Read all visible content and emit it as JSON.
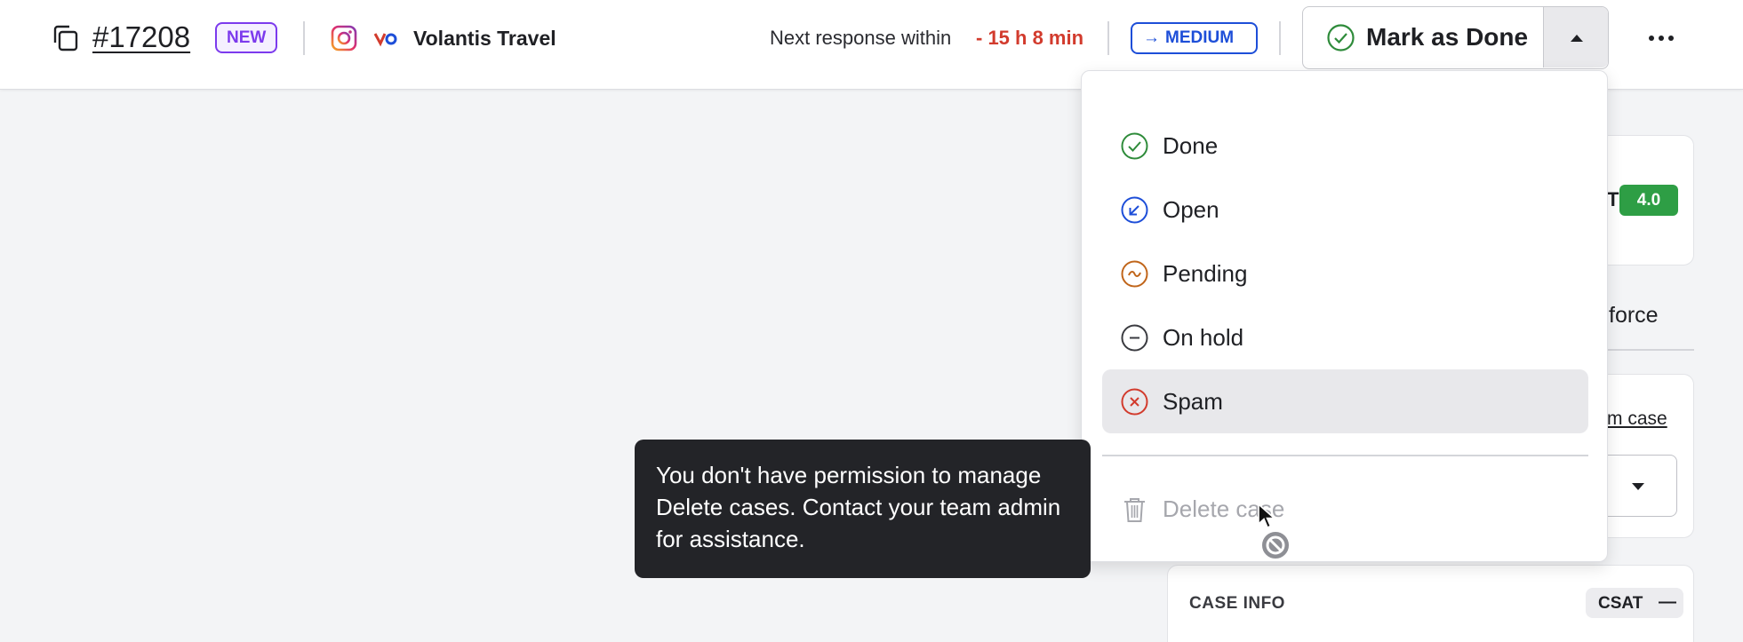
{
  "header": {
    "case_id": "#17208",
    "status_badge": "NEW",
    "company": "Volantis Travel",
    "next_response_label": "Next response within",
    "next_response_time": "- 15 h 8 min",
    "priority": "MEDIUM",
    "mark_done_label": "Mark as Done"
  },
  "background": {
    "card_top_text": "T",
    "score": "4.0",
    "force_text": "force",
    "link_text": "m case",
    "case_info_title": "CASE INFO",
    "csat_label": "CSAT",
    "csat_value": "—"
  },
  "menu": {
    "items": [
      {
        "label": "Done",
        "icon": "check-circle-icon",
        "color": "#2e8b3a"
      },
      {
        "label": "Open",
        "icon": "open-arrow-circle-icon",
        "color": "#1d4ed8"
      },
      {
        "label": "Pending",
        "icon": "tilde-circle-icon",
        "color": "#c0651a"
      },
      {
        "label": "On hold",
        "icon": "minus-circle-icon",
        "color": "#3a3b40"
      },
      {
        "label": "Spam",
        "icon": "x-circle-icon",
        "color": "#d23b2d"
      }
    ],
    "delete_label": "Delete case"
  },
  "tooltip": {
    "text": "You don't have permission to manage Delete cases. Contact your team admin for assistance."
  },
  "colors": {
    "accent_blue": "#1d4ed8",
    "danger": "#d23b2d",
    "success": "#2e9e45",
    "new_badge": "#7c3aed"
  }
}
